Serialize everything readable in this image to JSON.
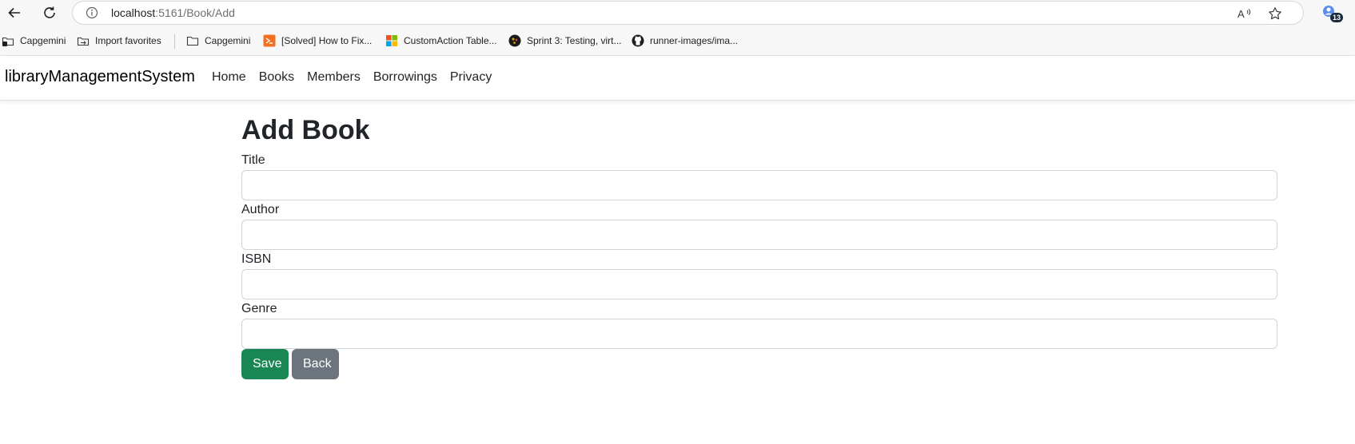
{
  "browser": {
    "url_host": "localhost",
    "url_path": ":5161/Book/Add",
    "tab_count": "13",
    "icons": {
      "back": "back-arrow-icon",
      "reload": "reload-icon",
      "info": "info-icon",
      "read_aloud": "read-aloud-icon",
      "favorite": "star-icon",
      "profile": "profile-icon"
    }
  },
  "bookmarks": [
    {
      "label": "Capgemini",
      "icon": "capgemini-folder-icon"
    },
    {
      "label": "Import favorites",
      "icon": "import-favorites-icon"
    },
    {
      "label": "Capgemini",
      "icon": "folder-icon"
    },
    {
      "label": "[Solved] How to Fix...",
      "icon": "site-icon"
    },
    {
      "label": "CustomAction Table...",
      "icon": "microsoft-icon"
    },
    {
      "label": "Sprint 3: Testing, virt...",
      "icon": "sprint-icon"
    },
    {
      "label": "runner-images/ima...",
      "icon": "github-icon"
    }
  ],
  "app": {
    "brand": "libraryManagementSystem",
    "nav": [
      "Home",
      "Books",
      "Members",
      "Borrowings",
      "Privacy"
    ]
  },
  "form": {
    "title": "Add Book",
    "fields": [
      {
        "label": "Title",
        "value": ""
      },
      {
        "label": "Author",
        "value": ""
      },
      {
        "label": "ISBN",
        "value": ""
      },
      {
        "label": "Genre",
        "value": ""
      }
    ],
    "save_label": "Save",
    "back_label": "Back"
  },
  "colors": {
    "save_button": "#198754",
    "back_button": "#6c757d"
  }
}
